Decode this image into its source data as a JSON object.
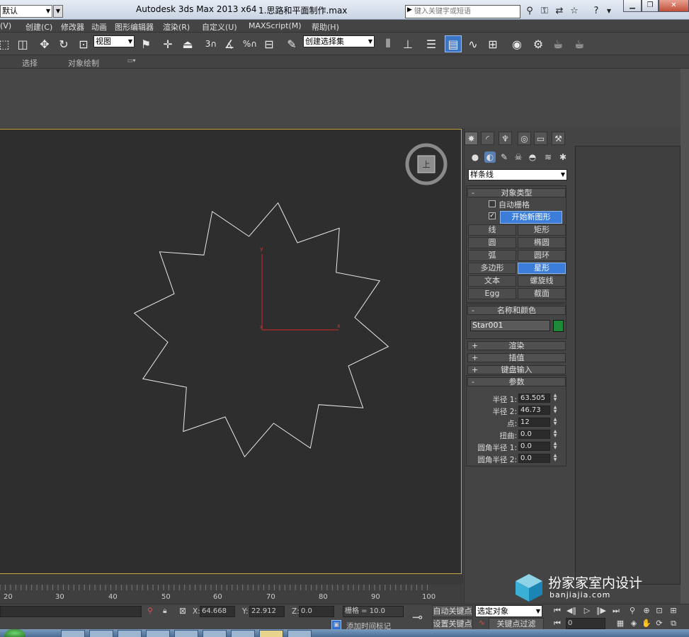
{
  "titlebar": {
    "workspace": "默认",
    "app_title": "Autodesk 3ds Max  2013 x64",
    "file_title": "1.思路和平面制作.max",
    "search_placeholder": "键入关键字或短语"
  },
  "menu": [
    "(V)",
    "创建(C)",
    "修改器",
    "动画",
    "图形编辑器",
    "渲染(R)",
    "自定义(U)",
    "MAXScript(M)",
    "帮助(H)"
  ],
  "toolbar": {
    "view_combo": "视图",
    "selection_set": "创建选择集",
    "snap_num": "3",
    "percent_snap": "%"
  },
  "ribbon": {
    "tabs": [
      "选择",
      "对象绘制"
    ]
  },
  "viewport": {
    "viewcube_label": "上",
    "axis_x": "x",
    "axis_y": "y",
    "axis_z": "z",
    "star": {
      "points": 12,
      "radius1": 63.505,
      "radius2": 46.73
    }
  },
  "panel": {
    "category": "样条线",
    "object_type": {
      "title": "对象类型",
      "auto_grid": "自动栅格",
      "start_new_shape": "开始新图形",
      "start_new_checked": "✓",
      "buttons": [
        {
          "label": "线",
          "active": false
        },
        {
          "label": "矩形",
          "active": false
        },
        {
          "label": "圆",
          "active": false
        },
        {
          "label": "椭圆",
          "active": false
        },
        {
          "label": "弧",
          "active": false
        },
        {
          "label": "圆环",
          "active": false
        },
        {
          "label": "多边形",
          "active": false
        },
        {
          "label": "星形",
          "active": true
        },
        {
          "label": "文本",
          "active": false
        },
        {
          "label": "螺旋线",
          "active": false
        },
        {
          "label": "Egg",
          "active": false
        },
        {
          "label": "截面",
          "active": false
        }
      ]
    },
    "name_color": {
      "title": "名称和颜色",
      "name": "Star001",
      "color": "#1d8a3a"
    },
    "rollouts": [
      {
        "sign": "+",
        "label": "渲染"
      },
      {
        "sign": "+",
        "label": "插值"
      },
      {
        "sign": "+",
        "label": "键盘输入"
      }
    ],
    "params": {
      "sign": "-",
      "title": "参数",
      "rows": [
        {
          "label": "半径 1:",
          "value": "63.505"
        },
        {
          "label": "半径 2:",
          "value": "46.73"
        },
        {
          "label": "点:",
          "value": "12"
        },
        {
          "label": "扭曲:",
          "value": "0.0"
        },
        {
          "label": "圆角半径 1:",
          "value": "0.0"
        },
        {
          "label": "圆角半径 2:",
          "value": "0.0"
        }
      ]
    }
  },
  "timeline": {
    "labels": [
      "20",
      "30",
      "40",
      "50",
      "60",
      "70",
      "80",
      "90",
      "100"
    ]
  },
  "status": {
    "x_label": "X:",
    "x_value": "64.668",
    "y_label": "Y:",
    "y_value": "22.912",
    "z_label": "Z:",
    "z_value": "0.0",
    "grid": "栅格 = 10.0",
    "add_time_tag": "添加时间标记",
    "auto_key": "自动关键点",
    "set_key": "设置关键点",
    "selected": "选定对象",
    "key_filters": "关键点过滤器...",
    "frame": "0"
  },
  "watermark": {
    "cn": "扮家家室内设计",
    "en": "banjiajia.com"
  }
}
